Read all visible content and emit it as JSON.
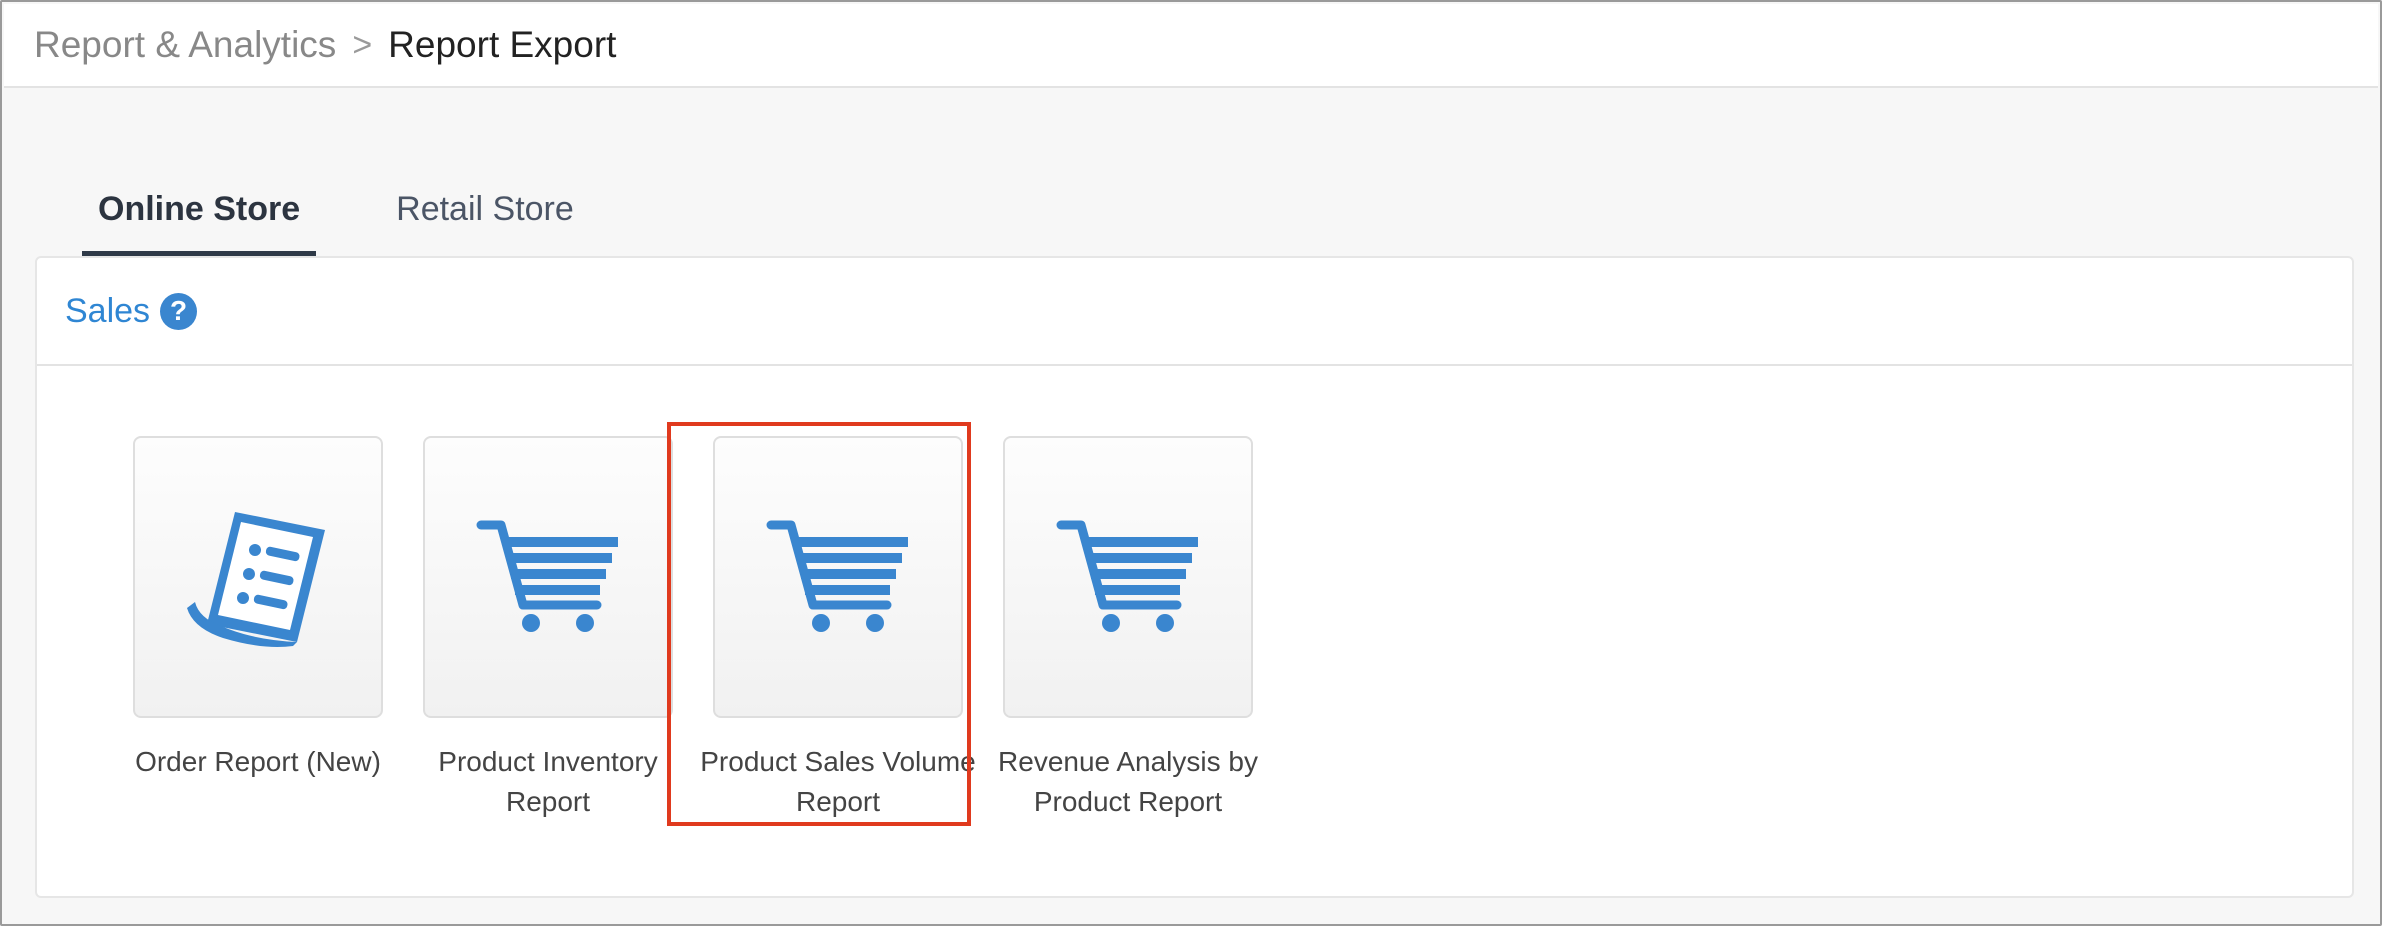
{
  "breadcrumb": {
    "parent": "Report & Analytics",
    "separator": ">",
    "current": "Report Export"
  },
  "tabs": [
    {
      "label": "Online Store",
      "active": true
    },
    {
      "label": "Retail Store",
      "active": false
    }
  ],
  "section": {
    "title": "Sales",
    "help_icon": "question-circle-icon"
  },
  "reports": [
    {
      "label": "Order Report (New)",
      "icon": "document-list-icon"
    },
    {
      "label": "Product Inventory Report",
      "icon": "shopping-cart-icon"
    },
    {
      "label": "Product Sales Volume Report",
      "icon": "shopping-cart-icon",
      "highlighted": true
    },
    {
      "label": "Revenue Analysis by Product Report",
      "icon": "shopping-cart-icon"
    }
  ],
  "colors": {
    "accent": "#3a86cf",
    "highlight": "#e03a1e",
    "tab_underline": "#2f3a48"
  }
}
